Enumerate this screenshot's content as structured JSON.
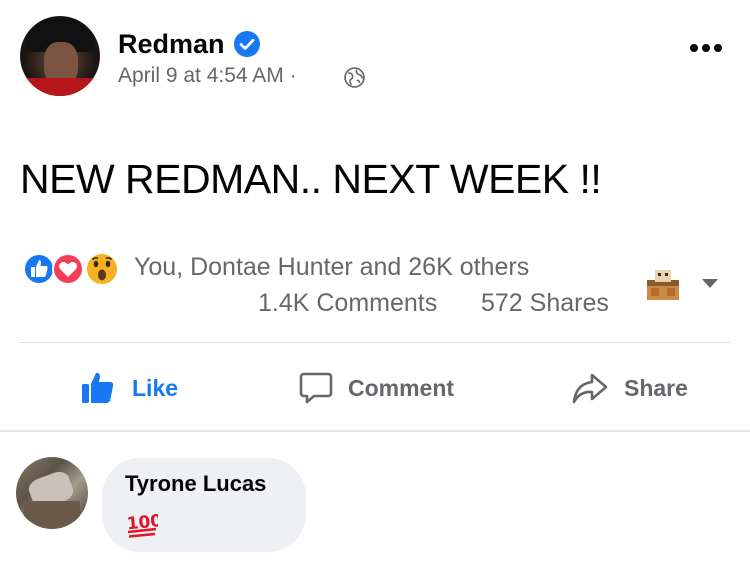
{
  "post": {
    "author": "Redman",
    "timestamp": "April 9 at 4:54 AM",
    "meta_separator": "·",
    "text": "NEW REDMAN.. NEXT WEEK !!"
  },
  "reactions": {
    "types": [
      "like-icon",
      "love-icon",
      "wow-icon"
    ],
    "reactors_text": "You, Dontae Hunter and 26K others",
    "comments_text": "1.4K Comments",
    "shares_text": "572 Shares"
  },
  "actions": {
    "like_label": "Like",
    "comment_label": "Comment",
    "share_label": "Share"
  },
  "comment": {
    "author": "Tyrone Lucas",
    "emoji": "💯"
  },
  "colors": {
    "facebook_blue": "#1877f2",
    "secondary_text": "#65676b",
    "love_red": "#f33e58",
    "wow_yellow": "#f7b125",
    "bubble_bg": "#eef0f3"
  }
}
